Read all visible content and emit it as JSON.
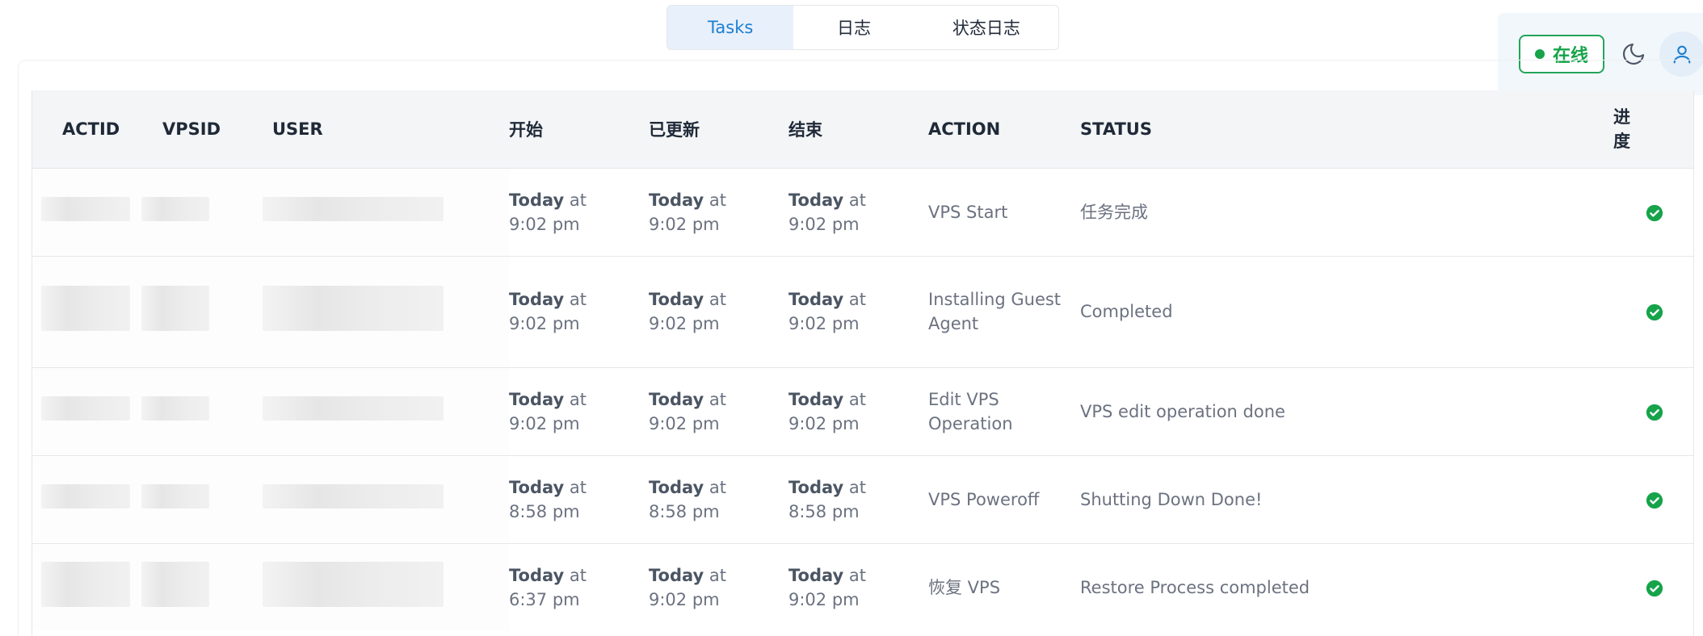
{
  "tabs": [
    {
      "label": "Tasks",
      "active": true
    },
    {
      "label": "日志",
      "active": false
    },
    {
      "label": "状态日志",
      "active": false
    }
  ],
  "header_right": {
    "status_label": "在线",
    "status_color": "#16a34a",
    "theme_icon": "moon-icon",
    "user_icon": "user-icon"
  },
  "table": {
    "columns": [
      "ACTID",
      "VPSID",
      "USER",
      "开始",
      "已更新",
      "结束",
      "ACTION",
      "STATUS",
      "进度"
    ],
    "progress_header_lines": [
      "进",
      "度"
    ],
    "rows": [
      {
        "start": {
          "day": "Today",
          "at": "at",
          "time": "9:02 pm"
        },
        "updated": {
          "day": "Today",
          "at": "at",
          "time": "9:02 pm"
        },
        "end": {
          "day": "Today",
          "at": "at",
          "time": "9:02 pm"
        },
        "action": "VPS Start",
        "status": "任务完成",
        "progress_icon": "check-circle-icon"
      },
      {
        "start": {
          "day": "Today",
          "at": "at",
          "time": "9:02 pm"
        },
        "updated": {
          "day": "Today",
          "at": "at",
          "time": "9:02 pm"
        },
        "end": {
          "day": "Today",
          "at": "at",
          "time": "9:02 pm"
        },
        "action": "Installing Guest Agent",
        "status": "Completed",
        "progress_icon": "check-circle-icon"
      },
      {
        "start": {
          "day": "Today",
          "at": "at",
          "time": "9:02 pm"
        },
        "updated": {
          "day": "Today",
          "at": "at",
          "time": "9:02 pm"
        },
        "end": {
          "day": "Today",
          "at": "at",
          "time": "9:02 pm"
        },
        "action": "Edit VPS Operation",
        "status": "VPS edit operation done",
        "progress_icon": "check-circle-icon"
      },
      {
        "start": {
          "day": "Today",
          "at": "at",
          "time": "8:58 pm"
        },
        "updated": {
          "day": "Today",
          "at": "at",
          "time": "8:58 pm"
        },
        "end": {
          "day": "Today",
          "at": "at",
          "time": "8:58 pm"
        },
        "action": "VPS Poweroff",
        "status": "Shutting Down Done!",
        "progress_icon": "check-circle-icon"
      },
      {
        "start": {
          "day": "Today",
          "at": "at",
          "time": "6:37 pm"
        },
        "updated": {
          "day": "Today",
          "at": "at",
          "time": "9:02 pm"
        },
        "end": {
          "day": "Today",
          "at": "at",
          "time": "9:02 pm"
        },
        "action": "恢复 VPS",
        "status": "Restore Process completed",
        "progress_icon": "check-circle-icon"
      }
    ]
  },
  "colors": {
    "accent": "#1d7fd0",
    "success": "#16a34a",
    "header_bg": "#f3f5f7"
  }
}
